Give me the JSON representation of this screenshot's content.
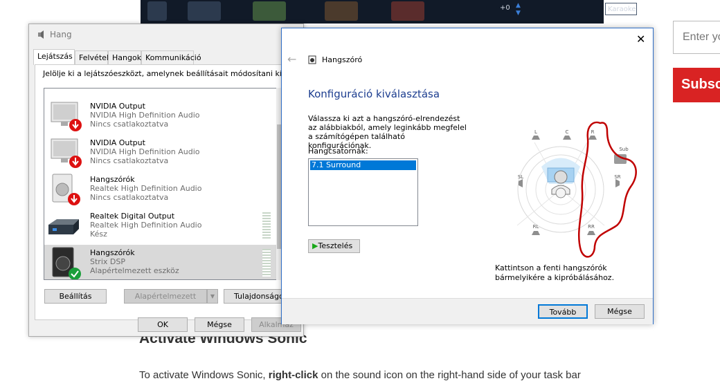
{
  "background": {
    "karaoke_label": "Karaoke",
    "karaoke_value": "+0",
    "email_placeholder": "Enter yo",
    "subscribe_label": "Subsc",
    "article_heading": "Activate Windows Sonic",
    "article_text_start": "To activate Windows Sonic, ",
    "article_text_bold": "right-click",
    "article_text_end": " on the sound icon on the right-hand side of your task bar"
  },
  "hang": {
    "title": "Hang",
    "tabs": [
      "Lejátszás",
      "Felvétel",
      "Hangok",
      "Kommunikáció"
    ],
    "instruction": "Jelölje ki a lejátszóeszközt, amelynek beállításait módosítani kívánja:",
    "devices": [
      {
        "name": "NVIDIA Output",
        "driver": "NVIDIA High Definition Audio",
        "status": "Nincs csatlakoztatva"
      },
      {
        "name": "NVIDIA Output",
        "driver": "NVIDIA High Definition Audio",
        "status": "Nincs csatlakoztatva"
      },
      {
        "name": "Hangszórók",
        "driver": "Realtek High Definition Audio",
        "status": "Nincs csatlakoztatva"
      },
      {
        "name": "Realtek Digital Output",
        "driver": "Realtek High Definition Audio",
        "status": "Kész"
      },
      {
        "name": "Hangszórók",
        "driver": "Strix DSP",
        "status": "Alapértelmezett eszköz"
      }
    ],
    "btn_configure": "Beállítás",
    "btn_default": "Alapértelmezett",
    "btn_properties": "Tulajdonságok",
    "btn_ok": "OK",
    "btn_cancel": "Mégse",
    "btn_apply": "Alkalmaz"
  },
  "speaker": {
    "title": "Hangszóró",
    "heading": "Konfiguráció kiválasztása",
    "description": "Válassza ki azt a hangszóró-elrendezést az alábbiakból, amely leginkább megfelel a számítógépen található konfigurációnak.",
    "channels_label": "Hangcsatornák:",
    "channel_options": [
      "7.1 Surround"
    ],
    "test_button": "Tesztelés",
    "hint": "Kattintson a fenti hangszórók bármelyikére a kipróbálásához.",
    "speaker_labels": [
      "L",
      "C",
      "R",
      "Sub",
      "SL",
      "SR",
      "RL",
      "RR"
    ],
    "btn_next": "Tovább",
    "btn_cancel": "Mégse",
    "annotation_color": "#c00000"
  }
}
